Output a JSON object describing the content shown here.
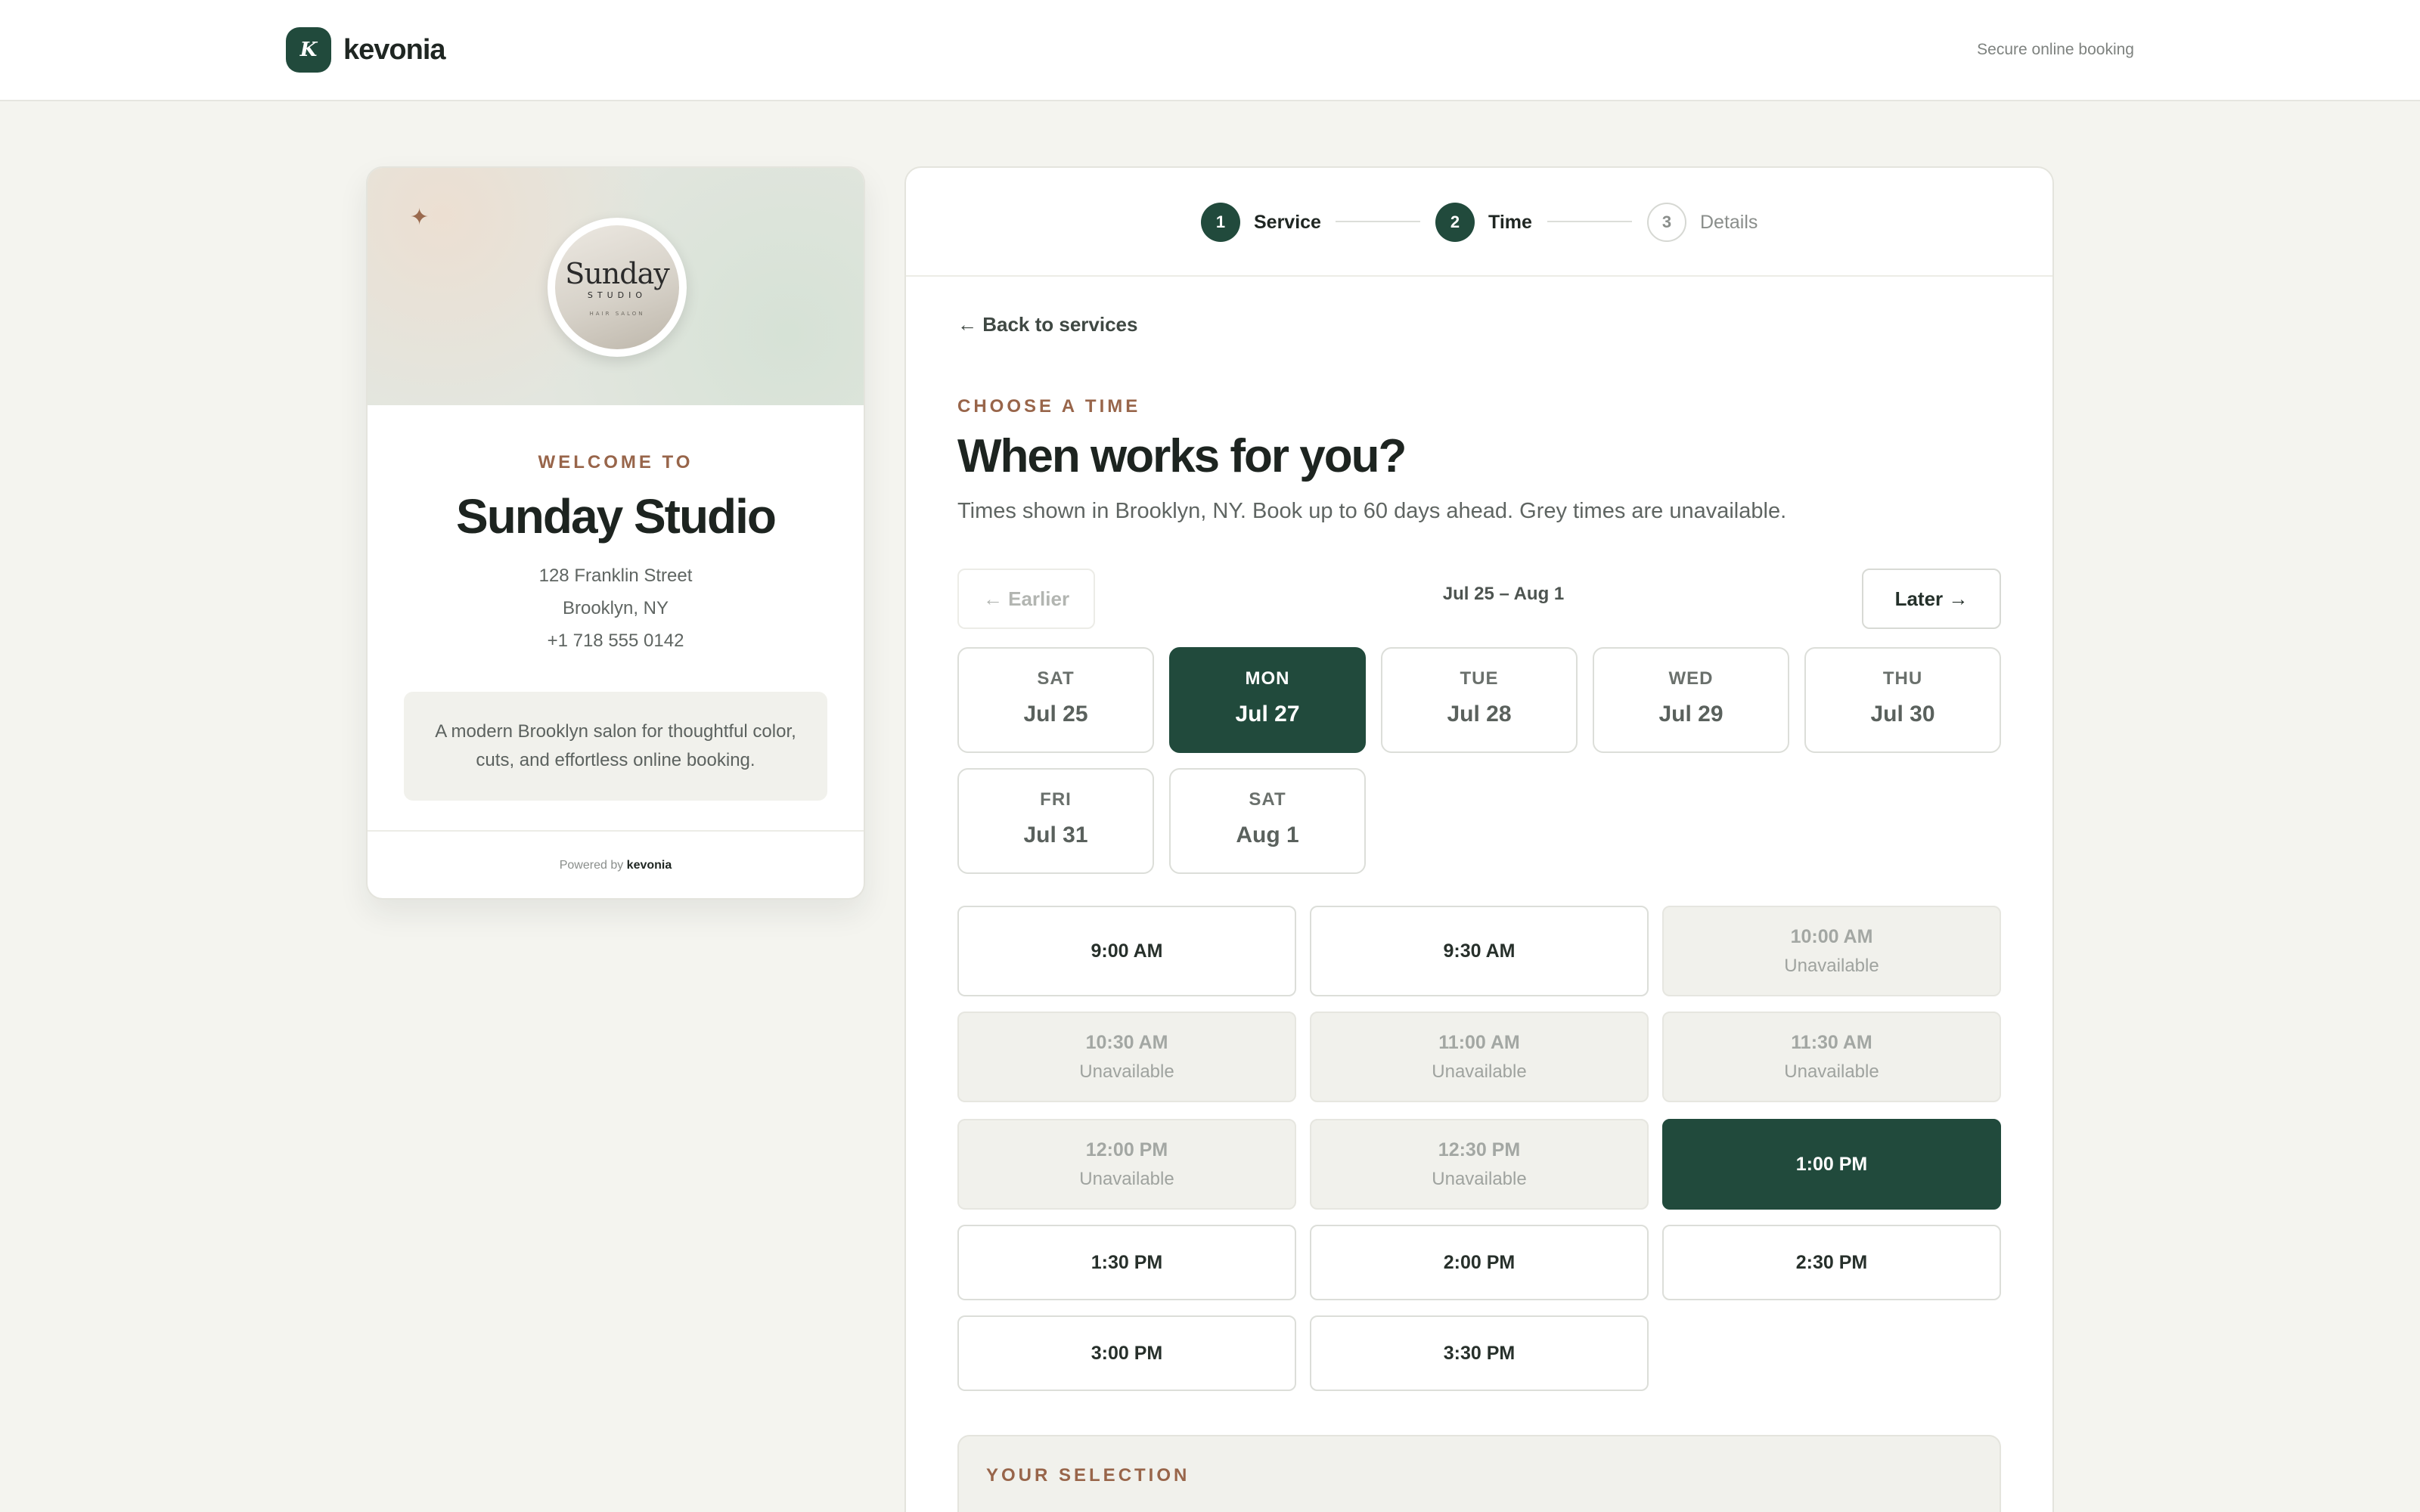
{
  "header": {
    "brand_initial": "K",
    "brand_name": "kevonia",
    "note": "Secure online booking"
  },
  "store": {
    "welcome": "WELCOME TO",
    "name": "Sunday Studio",
    "address_line1": "128 Franklin Street",
    "address_line2": "Brooklyn, NY",
    "phone": "+1 718 555 0142",
    "description": "A modern Brooklyn salon for thoughtful color, cuts, and effortless online booking.",
    "logo_text": "Sunday",
    "logo_sub": "STUDIO",
    "logo_tiny": "HAIR SALON",
    "powered_prefix": "Powered by",
    "powered_brand": "kevonia"
  },
  "steps": [
    {
      "number": "1",
      "label": "Service",
      "state": "done"
    },
    {
      "number": "2",
      "label": "Time",
      "state": "current"
    },
    {
      "number": "3",
      "label": "Details",
      "state": "upcoming"
    }
  ],
  "booking": {
    "back_link": "← Back to services",
    "eyebrow": "CHOOSE A TIME",
    "heading": "When works for you?",
    "subtext": "Times shown in Brooklyn, NY. Book up to 60 days ahead. Grey times are unavailable.",
    "earlier_label": "← Earlier",
    "later_label": "Later →",
    "range_label": "Jul 25 – Aug 1",
    "days": [
      {
        "dow": "SAT",
        "date": "Jul 25",
        "selected": false
      },
      {
        "dow": "MON",
        "date": "Jul 27",
        "selected": true
      },
      {
        "dow": "TUE",
        "date": "Jul 28",
        "selected": false
      },
      {
        "dow": "WED",
        "date": "Jul 29",
        "selected": false
      },
      {
        "dow": "THU",
        "date": "Jul 30",
        "selected": false
      },
      {
        "dow": "FRI",
        "date": "Jul 31",
        "selected": false
      },
      {
        "dow": "SAT",
        "date": "Aug 1",
        "selected": false
      }
    ],
    "unavailable_label": "Unavailable",
    "slots": [
      {
        "time": "9:00 AM",
        "status": "available"
      },
      {
        "time": "9:30 AM",
        "status": "available"
      },
      {
        "time": "10:00 AM",
        "status": "unavailable"
      },
      {
        "time": "10:30 AM",
        "status": "unavailable"
      },
      {
        "time": "11:00 AM",
        "status": "unavailable"
      },
      {
        "time": "11:30 AM",
        "status": "unavailable"
      },
      {
        "time": "12:00 PM",
        "status": "unavailable"
      },
      {
        "time": "12:30 PM",
        "status": "unavailable"
      },
      {
        "time": "1:00 PM",
        "status": "selected"
      },
      {
        "time": "1:30 PM",
        "status": "available"
      },
      {
        "time": "2:00 PM",
        "status": "available"
      },
      {
        "time": "2:30 PM",
        "status": "available"
      },
      {
        "time": "3:00 PM",
        "status": "available"
      },
      {
        "time": "3:30 PM",
        "status": "available"
      }
    ],
    "selection_title": "YOUR SELECTION"
  },
  "colors": {
    "accent": "#214a3c",
    "eyebrow": "#98654a",
    "background": "#f4f4ef"
  }
}
